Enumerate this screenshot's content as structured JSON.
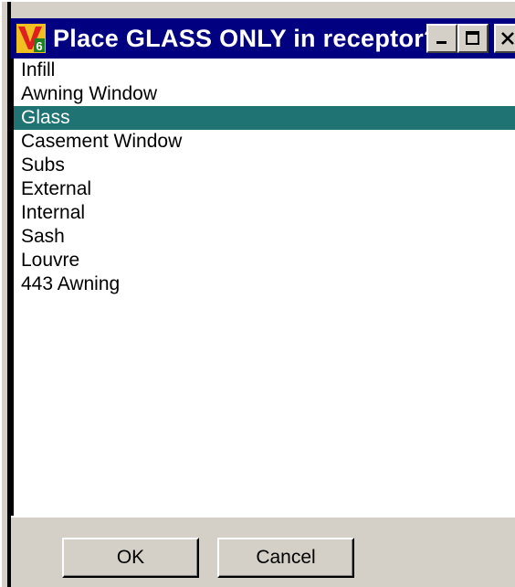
{
  "dialog": {
    "title": "Place GLASS ONLY in receptor?",
    "titlebar_color": "#000080",
    "selection_color": "#1f7373",
    "icon": "v6-app-icon"
  },
  "list": {
    "items": [
      "Infill",
      "Awning Window",
      "Glass",
      "Casement Window",
      "Subs",
      "External",
      "Internal",
      "Sash",
      "Louvre",
      "443 Awning"
    ],
    "selected": "Glass"
  },
  "buttons": {
    "ok_label": "OK",
    "cancel_label": "Cancel"
  }
}
